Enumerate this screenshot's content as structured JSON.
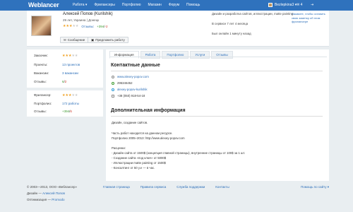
{
  "header": {
    "logo": "Weblancer",
    "nav": [
      "Работа ▾",
      "Фрилансеры",
      "Портфолио",
      "Магазин",
      "Форум",
      "Помощь"
    ],
    "user": "Bezlepkina3 ▾",
    "mail_count": "✉ 4",
    "exit_icon": "exit-icon"
  },
  "profile": {
    "name": "Алексей Попов (Kurilshik)",
    "meta": "29 лет, Украина | Донецк",
    "reviews_label": "Отзывы:",
    "reviews_pos": "+394",
    "reviews_sep": "/",
    "reviews_neg": "-2",
    "rating_stars": 3,
    "message_button": "Сообщение",
    "offer_button": "Предложить работу",
    "specs": "Дизайн и разработка сайтов, иллюстрации, matte painting",
    "service_time": "В сервисе 7 лет 4 месяца",
    "last_online": "Был онлайн 1 минуту назад",
    "note": "Нажмите, чтобы оставить свою заметку об этом фрилансере"
  },
  "sidebar": {
    "employer": {
      "label": "Заказчик:",
      "stars": 3
    },
    "projects": {
      "label": "Проекты:",
      "value": "13 проектов"
    },
    "vacancies": {
      "label": "Вакансии:",
      "value": "3 вакансии"
    },
    "reviews": {
      "label": "Отзывы:",
      "pos": "6",
      "sep": "/",
      "neg": "2"
    },
    "freelancer": {
      "label": "Фрилансер:",
      "stars": 3
    },
    "portfolio": {
      "label": "Портфолио:",
      "value": "172 работы"
    },
    "freviews": {
      "label": "Отзывы:",
      "pos": "+394",
      "sep": "/",
      "neg": "6"
    }
  },
  "tabs": [
    "Информация",
    "Работа",
    "Портфолио",
    "Услуги",
    "Отзывы"
  ],
  "contacts": {
    "title": "Контактные данные",
    "site": "www.alexey-popov.com",
    "icq": "295346452",
    "skype": "alexey-popov-kurilshik",
    "phone": "+38 (050) 918-54-18"
  },
  "extra": {
    "title": "Дополнительная информация",
    "lines": [
      "Дизайн, создание сайтов.",
      "",
      "Часть работ находится на данном ресурсе.",
      "Портфолио 2005–2013: http://www.alexey-popov.com",
      "",
      "Расценки:",
      "- Дизайн сайта от 1500$ (концепция главной страницы), внутренние страницы от 100$ за 1 шт.",
      "- Создание сайта «под ключ» от 5000$",
      "- Иллюстрации matte painting от 1500$",
      "- Консалтинг от 50 у.е — в час."
    ]
  },
  "footer": {
    "copyright": "© 2003—2013, ООО «Веблансер»",
    "design_label": "Дизайн —",
    "design_name": "Алексей Попов",
    "dev_label": "Оптимизация —",
    "dev_name": "Promodo",
    "links": [
      "Главная страница",
      "Правила сервиса",
      "Служба поддержки",
      "Контакты"
    ],
    "help": "Помощь по сайту ▾"
  },
  "colors": {
    "brand": "#2f72bd",
    "link": "#2a6db8",
    "positive": "#3c9a2f",
    "negative": "#d03a2a",
    "star": "#f0a020"
  }
}
